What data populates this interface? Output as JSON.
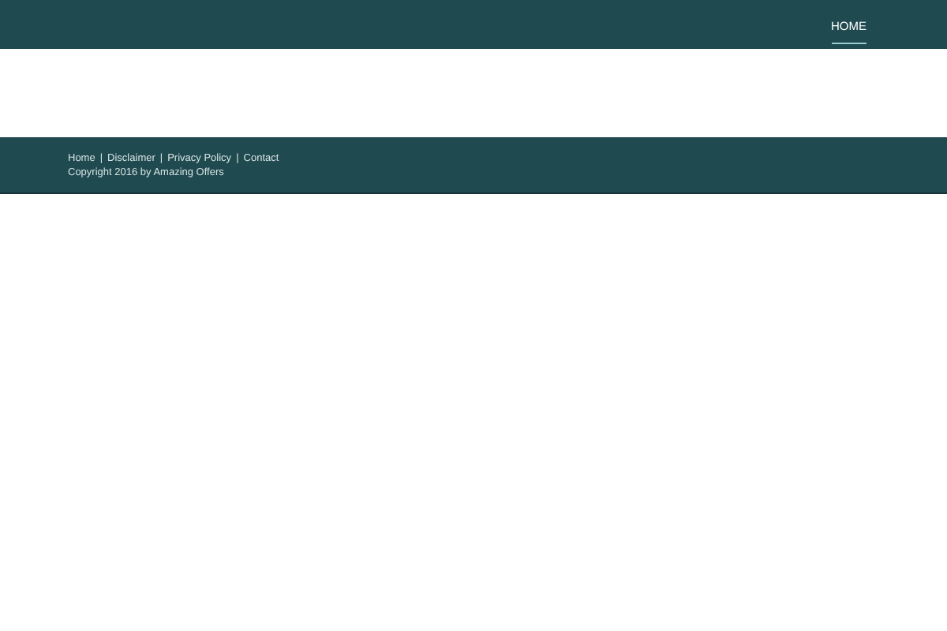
{
  "nav": {
    "items": [
      {
        "label": "HOME",
        "selected": true
      }
    ]
  },
  "footer": {
    "links": [
      "Home",
      "Disclaimer",
      "Privacy Policy",
      "Contact"
    ],
    "separator": "|",
    "copyright": "Copyright 2016 by Amazing Offers"
  }
}
